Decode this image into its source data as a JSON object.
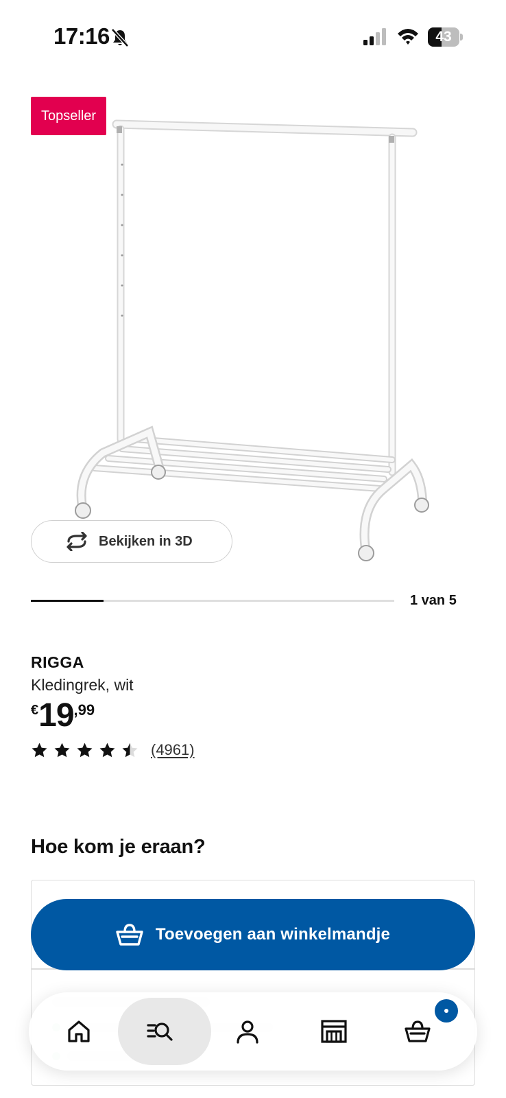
{
  "status_bar": {
    "time": "17:16",
    "battery": "43",
    "battery_level": 0.43,
    "icons": [
      "bell-slash-icon",
      "cellular-signal-icon",
      "wifi-icon",
      "battery-icon"
    ]
  },
  "product": {
    "badge": "Topseller",
    "view_3d_label": "Bekijken in 3D",
    "view_3d_icon": "rotate-icon",
    "carousel": {
      "label": "1 van 5",
      "current": 1,
      "total": 5
    },
    "name": "RIGGA",
    "description": "Kledingrek, wit",
    "price": {
      "currency": "€",
      "whole": "19",
      "decimal": ",99"
    },
    "rating": {
      "stars": 4.5,
      "max": 5,
      "count_label": "(4961)"
    }
  },
  "availability": {
    "heading": "Hoe kom je eraan?"
  },
  "add_to_cart": {
    "label": "Toevoegen aan winkelmandje",
    "icon": "basket-icon"
  },
  "bottom_nav": {
    "items": [
      {
        "name": "home",
        "icon": "home-icon"
      },
      {
        "name": "search",
        "icon": "search-list-icon",
        "active": true
      },
      {
        "name": "account",
        "icon": "person-icon"
      },
      {
        "name": "store",
        "icon": "store-icon"
      },
      {
        "name": "cart",
        "icon": "basket-icon"
      }
    ]
  },
  "colors": {
    "badge": "#e2004f",
    "primary_blue": "#0058a3",
    "text": "#111111"
  }
}
